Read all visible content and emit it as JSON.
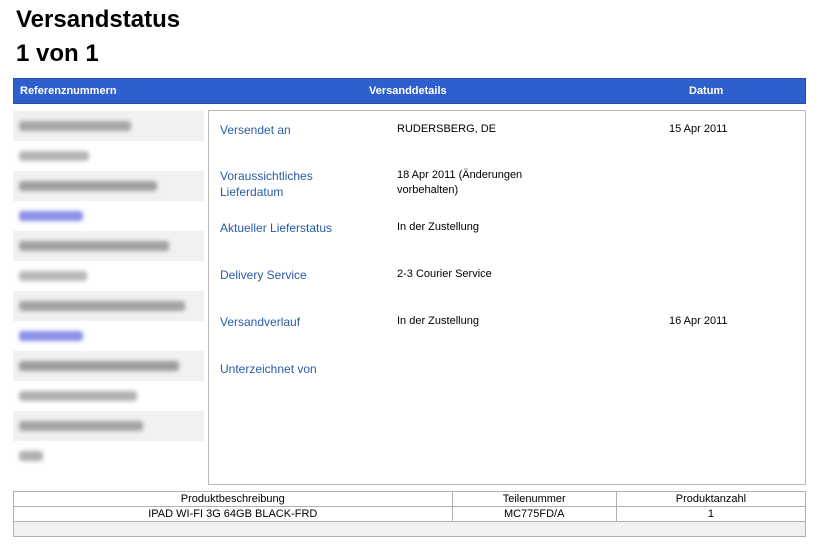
{
  "page": {
    "title": "Versandstatus",
    "subtitle": "1 von 1"
  },
  "header": {
    "ref_label": "Referenznummern",
    "details_label": "Versanddetails",
    "date_label": "Datum"
  },
  "details": [
    {
      "label": "Versendet an",
      "value": "RUDERSBERG, DE",
      "date": "15 Apr 2011"
    },
    {
      "label": "Voraussichtliches Lieferdatum",
      "value": "18 Apr 2011 (Änderungen vorbehalten)",
      "date": ""
    },
    {
      "label": "Aktueller Lieferstatus",
      "value": "In der Zustellung",
      "date": ""
    },
    {
      "label": "Delivery Service",
      "value": "2-3 Courier Service",
      "date": ""
    },
    {
      "label": "Versandverlauf",
      "value": "In der Zustellung",
      "date": "16 Apr 2011"
    },
    {
      "label": "Unterzeichnet von",
      "value": "",
      "date": ""
    }
  ],
  "products": {
    "headers": [
      "Produktbeschreibung",
      "Teilenummer",
      "Produktanzahl"
    ],
    "rows": [
      [
        "IPAD WI-FI 3G 64GB BLACK-FRD",
        "MC775FD/A",
        "1"
      ]
    ]
  },
  "colors": {
    "header_bar": "#2f5fcc",
    "label_blue": "#2a5aa8",
    "link_blur": "#8a8ee8",
    "gray_blur": "#9a9a9a"
  }
}
